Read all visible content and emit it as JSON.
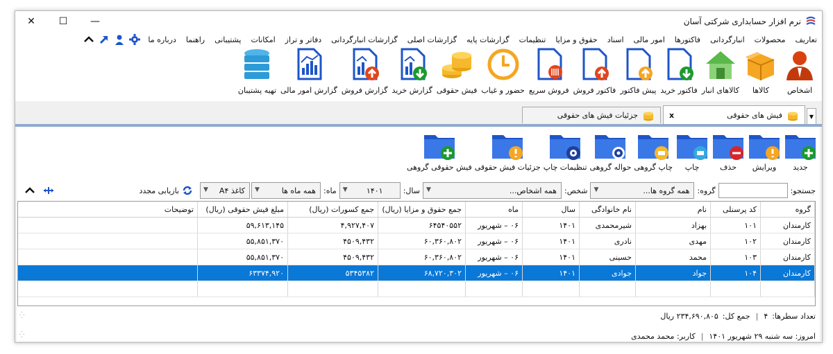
{
  "window": {
    "title": "نرم افزار حسابداری شرکتی آسان",
    "minimize": "—",
    "maximize": "☐",
    "close": "✕"
  },
  "menu": {
    "items": [
      "تعاریف",
      "محصولات",
      "انبارگردانی",
      "فاکتورها",
      "امور مالی",
      "اسناد",
      "حقوق و مزایا",
      "تنظیمات",
      "گزارشات پایه",
      "گزارشات اصلی",
      "گزارشات انبارگردانی",
      "دفاتر و تراز",
      "امکانات",
      "پشتیبانی",
      "راهنما",
      "درباره ما"
    ],
    "colors": {
      "icon": "#1e55c8"
    }
  },
  "ribbon": {
    "buttons": [
      {
        "label": "اشخاص",
        "icon": "person-icon"
      },
      {
        "label": "کالاها",
        "icon": "box-icon"
      },
      {
        "label": "کالاهای انبار",
        "icon": "warehouse-icon"
      },
      {
        "label": "فاکتور خرید",
        "icon": "purchase-invoice-icon"
      },
      {
        "label": "پیش فاکتور",
        "icon": "proforma-icon"
      },
      {
        "label": "فاکتور فروش",
        "icon": "sales-invoice-icon"
      },
      {
        "label": "فروش سریع",
        "icon": "quick-sale-icon"
      },
      {
        "label": "حضور و غیاب",
        "icon": "clock-icon"
      },
      {
        "label": "فیش حقوقی",
        "icon": "coins-icon"
      },
      {
        "label": "گزارش خرید",
        "icon": "purchase-report-icon"
      },
      {
        "label": "گزارش فروش",
        "icon": "sales-report-icon"
      },
      {
        "label": "گزارش امور مالی",
        "icon": "finance-report-icon"
      },
      {
        "label": "تهیه پشتیبان",
        "icon": "database-icon"
      }
    ]
  },
  "tabs": {
    "active": "فیش های حقوقی",
    "inactive": "جزئیات فیش های حقوقی",
    "close": "x"
  },
  "toolbar": {
    "buttons": [
      {
        "label": "جدید",
        "icon": "folder-add-icon"
      },
      {
        "label": "ویرایش",
        "icon": "folder-edit-icon"
      },
      {
        "label": "حذف",
        "icon": "folder-delete-icon"
      },
      {
        "label": "چاپ",
        "icon": "folder-print-icon"
      },
      {
        "label": "چاپ گروهی",
        "icon": "folder-group-print-icon"
      },
      {
        "label": "حواله گروهی",
        "icon": "folder-gear-icon"
      },
      {
        "label": "تنظیمات چاپ",
        "icon": "folder-print-settings-icon"
      },
      {
        "label": "جزئیات فیش حقوقی",
        "icon": "folder-details-icon"
      },
      {
        "label": "فیش حقوقی گروهی",
        "icon": "folder-group-add-icon"
      }
    ]
  },
  "filters": {
    "search_label": "جستجو:",
    "search_value": "",
    "group_label": "گروه:",
    "group_value": "همه گروه ها...",
    "person_label": "شخص:",
    "person_value": "همه اشخاص...",
    "year_label": "سال:",
    "year_value": "۱۴۰۱",
    "month_label": "ماه:",
    "month_value": "همه ماه ها",
    "paper_value": "کاغذ A۴",
    "reload_label": "بازیابی مجدد"
  },
  "grid": {
    "columns": [
      "گروه",
      "کد پرسنلی",
      "نام",
      "نام خانوادگی",
      "سال",
      "ماه",
      "جمع حقوق و مزایا (ریال)",
      "جمع کسورات (ریال)",
      "مبلغ فیش حقوقی (ریال)",
      "توضیحات"
    ],
    "rows": [
      [
        "کارمندان",
        "۱۰۱",
        "بهزاد",
        "شیرمحمدی",
        "۱۴۰۱",
        "۰۶ – شهریور",
        "۶۴۵۴۰۵۵۲",
        "۴,۹۲۷,۴۰۷",
        "۵۹,۶۱۳,۱۴۵",
        ""
      ],
      [
        "کارمندان",
        "۱۰۲",
        "مهدی",
        "نادری",
        "۱۴۰۱",
        "۰۶ – شهریور",
        "۶۰,۳۶۰,۸۰۲",
        "۴۵۰۹,۴۳۲",
        "۵۵,۸۵۱,۳۷۰",
        ""
      ],
      [
        "کارمندان",
        "۱۰۳",
        "محمد",
        "حسینی",
        "۱۴۰۱",
        "۰۶ – شهریور",
        "۶۰,۳۶۰,۸۰۲",
        "۴۵۰۹,۴۳۲",
        "۵۵,۸۵۱,۳۷۰",
        ""
      ],
      [
        "کارمندان",
        "۱۰۴",
        "جواد",
        "جوادی",
        "۱۴۰۱",
        "۰۶ – شهریور",
        "۶۸,۷۲۰,۳۰۲",
        "۵۳۴۵۳۸۲",
        "۶۳۳۷۴,۹۲۰",
        ""
      ]
    ],
    "selected_row": 3,
    "colors": {
      "selection": "#0a78d7"
    }
  },
  "summary": {
    "rows_label": "تعداد سطرها:",
    "rows_value": "۴",
    "total_label": "جمع کل:",
    "total_value": "۲۳۴,۶۹۰,۸۰۵ ریال"
  },
  "status": {
    "today": "امروز: سه شنبه ۲۹ شهریور ۱۴۰۱",
    "user": "کاربر: محمد محمدی"
  }
}
